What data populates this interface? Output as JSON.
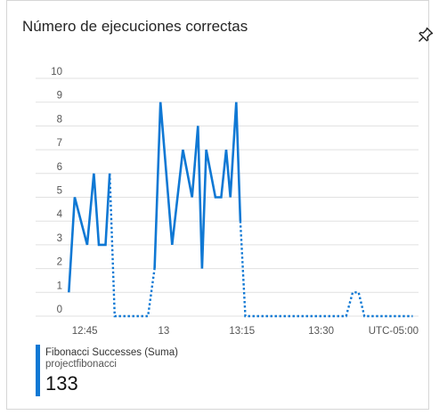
{
  "tile": {
    "title": "Número de ejecuciones correctas",
    "pin_icon": "pin-icon"
  },
  "chart_data": {
    "type": "line",
    "y_ticks": [
      "0",
      "1",
      "2",
      "3",
      "4",
      "5",
      "6",
      "7",
      "8",
      "9",
      "10"
    ],
    "ylim": [
      0,
      10
    ],
    "x_tick_labels": [
      "12:45",
      "13",
      "13:15",
      "13:30",
      "UTC-05:00"
    ],
    "x_range_minutes": [
      -5.5,
      37.5
    ],
    "x_tick_minutes": [
      0,
      15,
      30
    ],
    "gap_style": "dotted",
    "series": [
      {
        "name": "Fibonacci Successes (Suma)",
        "color": "#0f78d4",
        "segments": [
          {
            "style": "solid",
            "points": [
              [
                -4.5,
                1
              ],
              [
                -3.8,
                5
              ],
              [
                -2.3,
                3
              ],
              [
                -1.5,
                6
              ],
              [
                -0.9,
                3
              ],
              [
                -0.1,
                3
              ],
              [
                0.4,
                6
              ]
            ]
          },
          {
            "style": "dotted",
            "points": [
              [
                0.4,
                6
              ],
              [
                1.0,
                0
              ],
              [
                4.0,
                0
              ],
              [
                5.0,
                0
              ],
              [
                5.8,
                2
              ]
            ]
          },
          {
            "style": "solid",
            "points": [
              [
                5.8,
                2
              ],
              [
                6.5,
                9
              ],
              [
                7.9,
                3
              ],
              [
                9.2,
                7
              ],
              [
                10.3,
                5
              ],
              [
                11.0,
                8
              ],
              [
                11.5,
                2
              ],
              [
                12.0,
                7
              ],
              [
                13.1,
                5
              ],
              [
                13.8,
                5
              ],
              [
                14.4,
                7
              ],
              [
                14.9,
                5
              ],
              [
                15.6,
                9
              ],
              [
                16.1,
                4
              ]
            ]
          },
          {
            "style": "dotted",
            "points": [
              [
                16.1,
                4
              ],
              [
                16.7,
                0
              ],
              [
                25.0,
                0
              ],
              [
                28.8,
                0
              ],
              [
                29.6,
                1
              ],
              [
                30.3,
                1
              ],
              [
                31.0,
                0
              ],
              [
                36.8,
                0
              ]
            ]
          }
        ]
      }
    ]
  },
  "legend": {
    "series_name": "Fibonacci Successes (Suma)",
    "resource": "projectfibonacci",
    "total": "133",
    "color": "#0f78d4"
  }
}
